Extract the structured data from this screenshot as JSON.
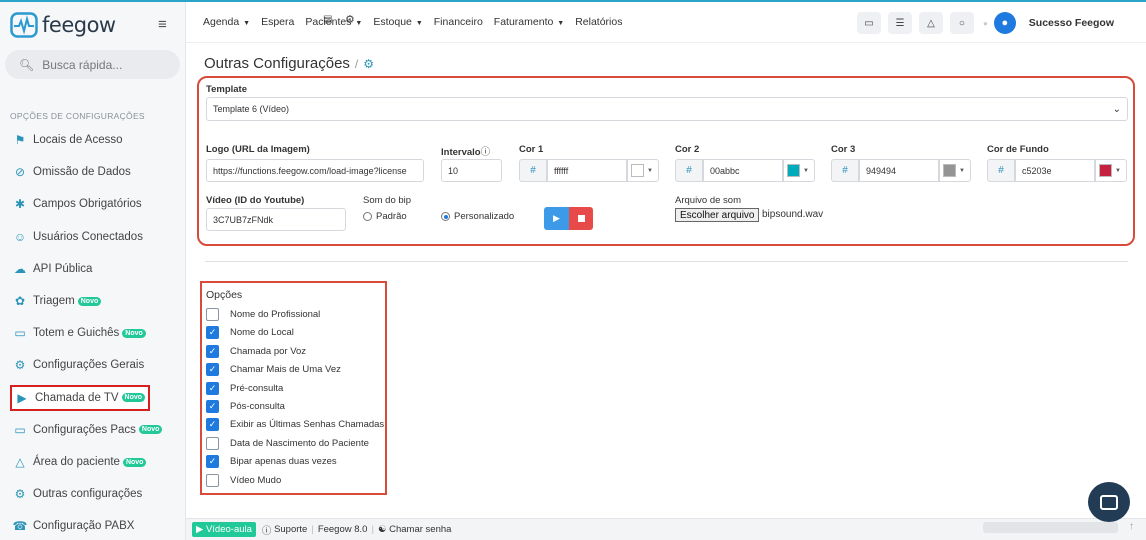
{
  "app": {
    "name": "feegow"
  },
  "sidebar": {
    "search_placeholder": "Busca rápida...",
    "section_title": "OPÇÕES DE CONFIGURAÇÕES",
    "items": [
      {
        "label": "Locais de Acesso",
        "icon": "building-icon",
        "badge": ""
      },
      {
        "label": "Omissão de Dados",
        "icon": "eye-slash-icon",
        "badge": ""
      },
      {
        "label": "Campos Obrigatórios",
        "icon": "asterisk-icon",
        "badge": ""
      },
      {
        "label": "Usuários Conectados",
        "icon": "user-icon",
        "badge": ""
      },
      {
        "label": "API Pública",
        "icon": "cloud-icon",
        "badge": ""
      },
      {
        "label": "Triagem",
        "icon": "stethoscope-icon",
        "badge": "Novo"
      },
      {
        "label": "Totem e Guichês",
        "icon": "monitor-icon",
        "badge": "Novo"
      },
      {
        "label": "Configurações Gerais",
        "icon": "gears-icon",
        "badge": ""
      },
      {
        "label": "Chamada de TV",
        "icon": "megaphone-icon",
        "badge": "Novo"
      },
      {
        "label": "Configurações Pacs",
        "icon": "monitor-icon",
        "badge": "Novo"
      },
      {
        "label": "Área do paciente",
        "icon": "flask-icon",
        "badge": "Novo"
      },
      {
        "label": "Outras configurações",
        "icon": "gears-icon",
        "badge": ""
      },
      {
        "label": "Configuração PABX",
        "icon": "phone-icon",
        "badge": ""
      }
    ]
  },
  "header": {
    "nav": [
      {
        "label": "Agenda",
        "caret": true
      },
      {
        "label": "Espera",
        "caret": false
      },
      {
        "label": "Pacientes",
        "caret": true
      },
      {
        "label": "Estoque",
        "caret": true
      },
      {
        "label": "Financeiro",
        "caret": false
      },
      {
        "label": "Faturamento",
        "caret": true
      },
      {
        "label": "Relatórios",
        "caret": false
      }
    ],
    "user_name": "Sucesso Feegow"
  },
  "page": {
    "title": "Outras Configurações",
    "breadcrumb_sep": "/"
  },
  "form": {
    "template_label": "Template",
    "template_value": "Template 6 (Vídeo)",
    "logo_label": "Logo (URL da Imagem)",
    "logo_value": "https://functions.feegow.com/load-image?license",
    "interval_label": "Intervalo",
    "interval_value": "10",
    "cor1_label": "Cor 1",
    "cor1_value": "ffffff",
    "cor1_color": "#ffffff",
    "cor2_label": "Cor 2",
    "cor2_value": "00abbc",
    "cor2_color": "#00abbc",
    "cor3_label": "Cor 3",
    "cor3_value": "949494",
    "cor3_color": "#949494",
    "corfundo_label": "Cor de Fundo",
    "corfundo_value": "c5203e",
    "corfundo_color": "#c5203e",
    "video_label": "Vídeo (ID do Youtube)",
    "video_value": "3C7UB7zFNdk",
    "bip_label": "Som do bip",
    "bip_opt1": "Padrão",
    "bip_opt2": "Personalizado",
    "bip_selected": "Personalizado",
    "sound_label": "Arquivo de som",
    "sound_button": "Escolher arquivo",
    "sound_file": "bipsound.wav",
    "hash": "#"
  },
  "options": {
    "title": "Opções",
    "items": [
      {
        "label": "Nome do Profissional",
        "checked": false
      },
      {
        "label": "Nome do Local",
        "checked": true
      },
      {
        "label": "Chamada por Voz",
        "checked": true
      },
      {
        "label": "Chamar Mais de Uma Vez",
        "checked": true
      },
      {
        "label": "Pré-consulta",
        "checked": true
      },
      {
        "label": "Pós-consulta",
        "checked": true
      },
      {
        "label": "Exibir as Últimas Senhas Chamadas",
        "checked": true
      },
      {
        "label": "Data de Nascimento do Paciente",
        "checked": false
      },
      {
        "label": "Bipar apenas duas vezes",
        "checked": true
      },
      {
        "label": "Vídeo Mudo",
        "checked": false
      }
    ]
  },
  "footer": {
    "video_aula": "Vídeo-aula",
    "suporte": "Suporte",
    "version": "Feegow 8.0",
    "chamar": "Chamar senha"
  },
  "colors": {
    "accent": "#2a93b8",
    "highlight": "#d84a3a",
    "badge": "#20c997"
  }
}
